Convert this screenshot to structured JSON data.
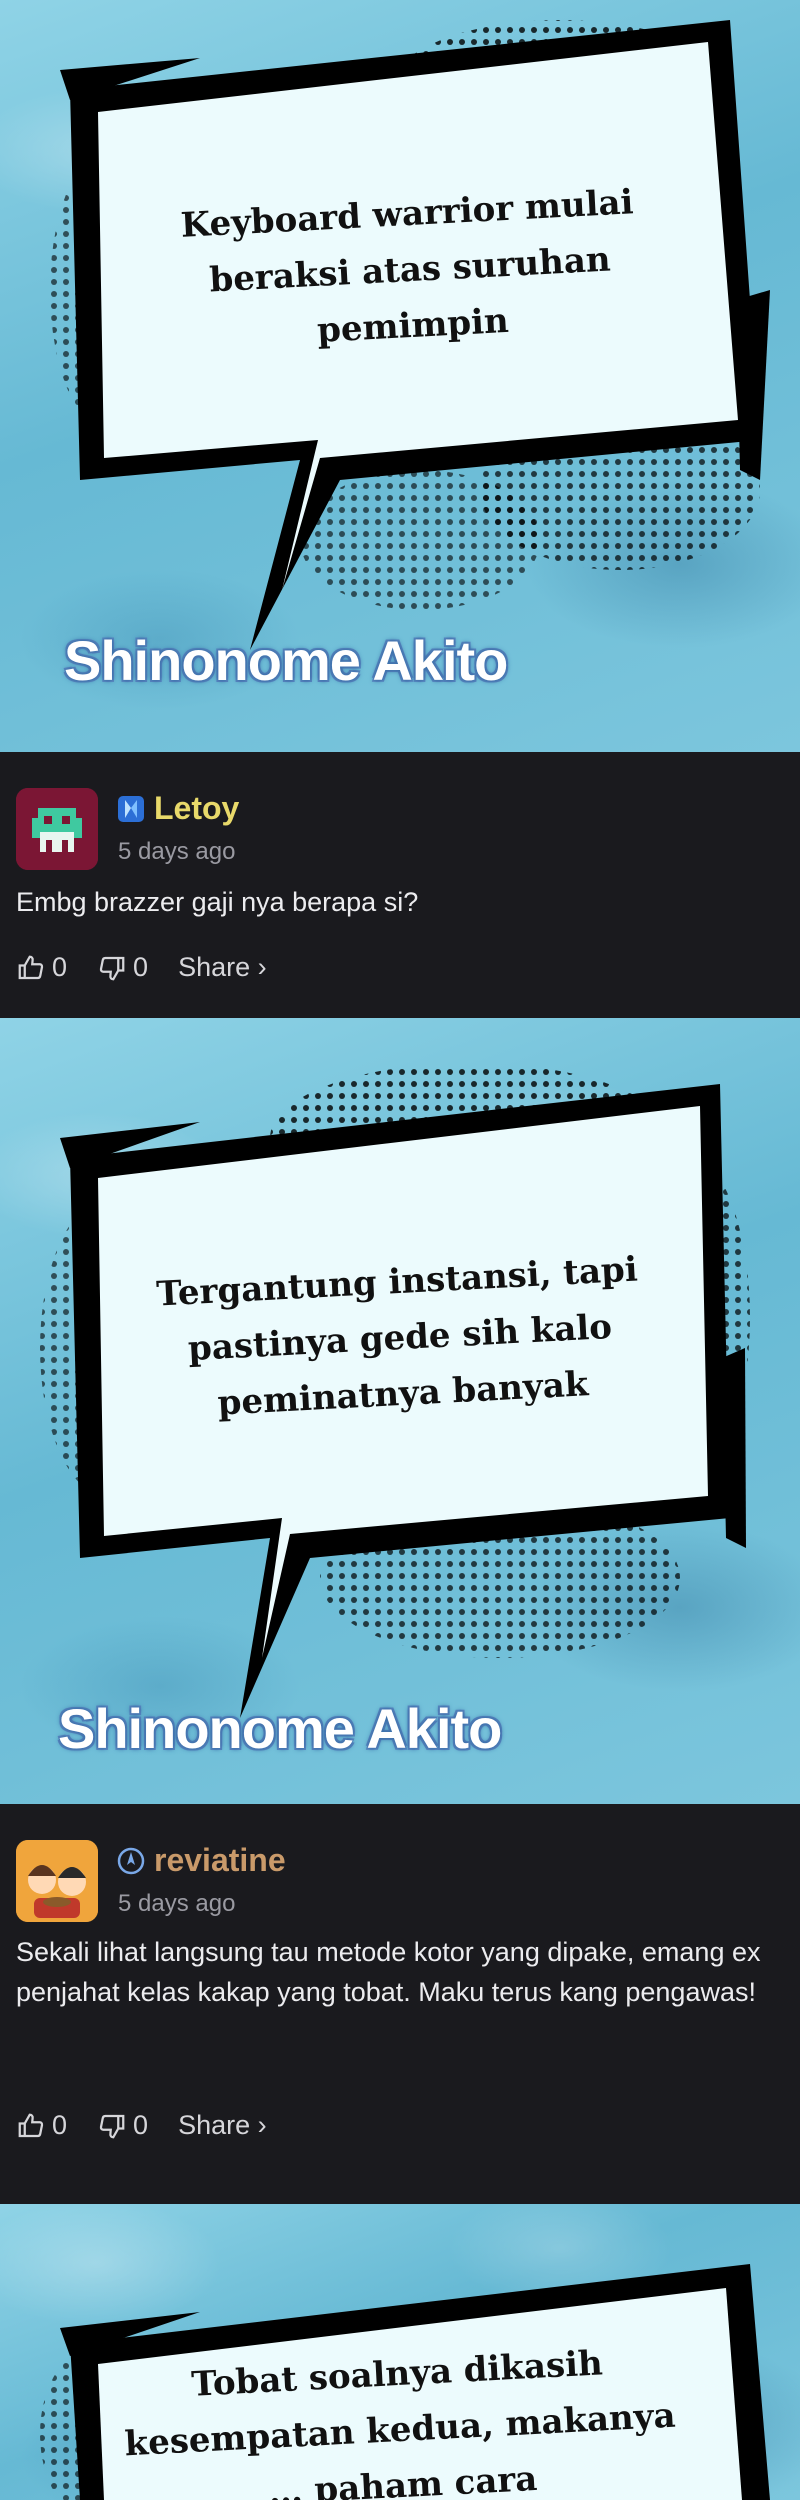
{
  "panels": [
    {
      "text": "Keyboard warrior mulai\nberaksi atas suruhan\npemimpin",
      "speaker": "Shinonome Akito"
    },
    {
      "text": "Tergantung instansi, tapi\npastinya gede sih kalo\npeminatnya banyak",
      "speaker": "Shinonome Akito"
    },
    {
      "text": "Tobat soalnya dikasih\nkesempatan kedua, makanya\n… paham cara",
      "speaker": ""
    }
  ],
  "comments": [
    {
      "username": "Letoy",
      "username_color": "#e8d96a",
      "time": "5 days ago",
      "body": "Embg brazzer gaji nya berapa si?",
      "likes": "0",
      "dislikes": "0",
      "share_label": "Share ›",
      "avatar_icon": "pixel-monster-avatar",
      "badge_icon": "blue-crystal-badge-icon"
    },
    {
      "username": "reviatine",
      "username_color": "#c99a6a",
      "time": "5 days ago",
      "body": "Sekali lihat langsung tau metode kotor yang dipake, emang ex penjahat kelas kakap yang tobat. Maku terus kang pengawas!",
      "likes": "0",
      "dislikes": "0",
      "share_label": "Share ›",
      "avatar_icon": "anime-characters-avatar",
      "badge_icon": "compass-badge-icon"
    }
  ]
}
